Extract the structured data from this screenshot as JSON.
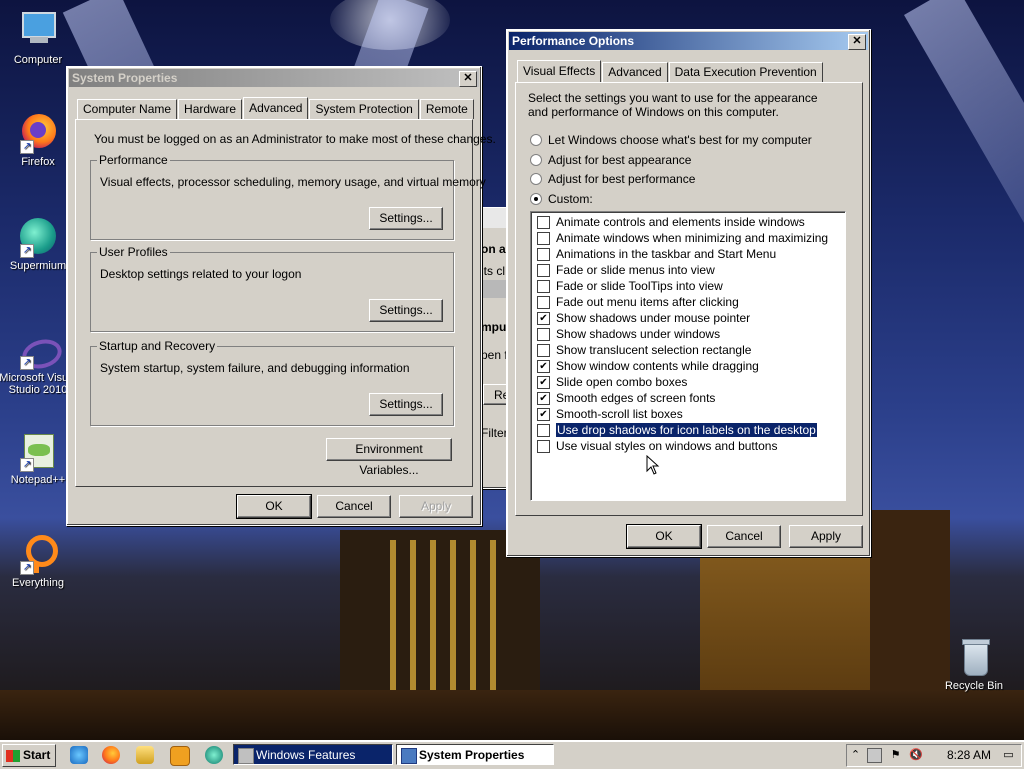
{
  "desktop": {
    "icons": [
      {
        "label": "Computer"
      },
      {
        "label": "Firefox"
      },
      {
        "label": "Supermium"
      },
      {
        "label": "Microsoft Visual Studio 2010"
      },
      {
        "label": "Notepad++"
      },
      {
        "label": "Everything"
      },
      {
        "label": "Recycle Bin"
      }
    ],
    "background_partial_window": {
      "fragments": [
        "on a",
        "its cl",
        "mpu",
        "pen fi",
        "Re",
        "Filter"
      ]
    }
  },
  "system_properties": {
    "title": "System Properties",
    "tabs": [
      "Computer Name",
      "Hardware",
      "Advanced",
      "System Protection",
      "Remote"
    ],
    "selected_tab": "Advanced",
    "admin_note": "You must be logged on as an Administrator to make most of these changes.",
    "performance": {
      "legend": "Performance",
      "desc": "Visual effects, processor scheduling, memory usage, and virtual memory",
      "button": "Settings..."
    },
    "user_profiles": {
      "legend": "User Profiles",
      "desc": "Desktop settings related to your logon",
      "button": "Settings..."
    },
    "startup": {
      "legend": "Startup and Recovery",
      "desc": "System startup, system failure, and debugging information",
      "button": "Settings..."
    },
    "env_button": "Environment Variables...",
    "ok": "OK",
    "cancel": "Cancel",
    "apply": "Apply"
  },
  "performance_options": {
    "title": "Performance Options",
    "tabs": [
      "Visual Effects",
      "Advanced",
      "Data Execution Prevention"
    ],
    "selected_tab": "Visual Effects",
    "intro": "Select the settings you want to use for the appearance and performance of Windows on this computer.",
    "radios": [
      {
        "label": "Let Windows choose what's best for my computer",
        "selected": false
      },
      {
        "label": "Adjust for best appearance",
        "selected": false
      },
      {
        "label": "Adjust for best performance",
        "selected": false
      },
      {
        "label": "Custom:",
        "selected": true
      }
    ],
    "effects": [
      {
        "label": "Animate controls and elements inside windows",
        "checked": false
      },
      {
        "label": "Animate windows when minimizing and maximizing",
        "checked": false
      },
      {
        "label": "Animations in the taskbar and Start Menu",
        "checked": false
      },
      {
        "label": "Fade or slide menus into view",
        "checked": false
      },
      {
        "label": "Fade or slide ToolTips into view",
        "checked": false
      },
      {
        "label": "Fade out menu items after clicking",
        "checked": false
      },
      {
        "label": "Show shadows under mouse pointer",
        "checked": true
      },
      {
        "label": "Show shadows under windows",
        "checked": false
      },
      {
        "label": "Show translucent selection rectangle",
        "checked": false
      },
      {
        "label": "Show window contents while dragging",
        "checked": true
      },
      {
        "label": "Slide open combo boxes",
        "checked": true
      },
      {
        "label": "Smooth edges of screen fonts",
        "checked": true
      },
      {
        "label": "Smooth-scroll list boxes",
        "checked": true
      },
      {
        "label": "Use drop shadows for icon labels on the desktop",
        "checked": false,
        "highlighted": true
      },
      {
        "label": "Use visual styles on windows and buttons",
        "checked": false
      }
    ],
    "ok": "OK",
    "cancel": "Cancel",
    "apply": "Apply"
  },
  "taskbar": {
    "start_label": "Start",
    "quick_launch": [
      "ie-icon",
      "firefox-icon",
      "explorer-icon",
      "media-player-icon",
      "supermium-icon"
    ],
    "buttons": [
      {
        "label": "Windows Features",
        "active": false
      },
      {
        "label": "System Properties",
        "active": true
      }
    ],
    "clock": "8:28 AM"
  }
}
